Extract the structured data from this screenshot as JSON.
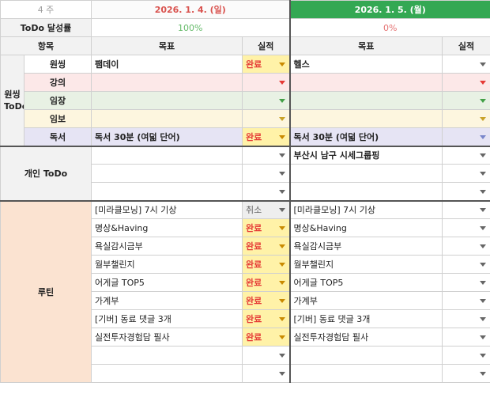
{
  "header": {
    "week": "4 주",
    "date1": "2026. 1. 4. (일)",
    "date2": "2026. 1. 5. (월)",
    "achievement_label": "ToDo 달성률",
    "pct1": "100%",
    "pct2": "0%",
    "col_item": "항목",
    "col_goal1": "목표",
    "col_result1": "실적",
    "col_goal2": "목표",
    "col_result2": "실적"
  },
  "wonssing": {
    "category": "원씽\nToDo",
    "rows": [
      {
        "sub": "원씽",
        "goal1": "팸데이",
        "status1": "완료",
        "goal2": "헬스",
        "status2": ""
      },
      {
        "sub": "강의",
        "goal1": "",
        "status1": "",
        "goal2": "",
        "status2": ""
      },
      {
        "sub": "임장",
        "goal1": "",
        "status1": "",
        "goal2": "",
        "status2": ""
      },
      {
        "sub": "임보",
        "goal1": "",
        "status1": "",
        "goal2": "",
        "status2": ""
      },
      {
        "sub": "독서",
        "goal1": "독서 30분 (여덟 단어)",
        "status1": "완료",
        "goal2": "독서 30분 (여덟 단어)",
        "status2": ""
      }
    ]
  },
  "personal": {
    "category": "개인 ToDo",
    "rows": [
      {
        "goal1": "",
        "status1": "",
        "goal2": "부산시 남구 시세그룹핑",
        "status2": ""
      },
      {
        "goal1": "",
        "status1": "",
        "goal2": "",
        "status2": ""
      },
      {
        "goal1": "",
        "status1": "",
        "goal2": "",
        "status2": ""
      }
    ]
  },
  "routine": {
    "category": "루틴",
    "rows": [
      {
        "goal1": "[미라클모닝] 7시 기상",
        "status1": "취소",
        "goal2": "[미라클모닝] 7시 기상",
        "status2": ""
      },
      {
        "goal1": "명상&Having",
        "status1": "완료",
        "goal2": "명상&Having",
        "status2": ""
      },
      {
        "goal1": "욕실감시금부",
        "status1": "완료",
        "goal2": "욕실감시금부",
        "status2": ""
      },
      {
        "goal1": "월부챌린지",
        "status1": "완료",
        "goal2": "월부챌린지",
        "status2": ""
      },
      {
        "goal1": "어게글 TOP5",
        "status1": "완료",
        "goal2": "어게글 TOP5",
        "status2": ""
      },
      {
        "goal1": "가계부",
        "status1": "완료",
        "goal2": "가계부",
        "status2": ""
      },
      {
        "goal1": "[기버] 동료 댓글 3개",
        "status1": "완료",
        "goal2": "[기버] 동료 댓글 3개",
        "status2": ""
      },
      {
        "goal1": "실전투자경험담 필사",
        "status1": "완료",
        "goal2": "실전투자경험담 필사",
        "status2": ""
      },
      {
        "goal1": "",
        "status1": "",
        "goal2": "",
        "status2": ""
      },
      {
        "goal1": "",
        "status1": "",
        "goal2": "",
        "status2": ""
      }
    ]
  }
}
